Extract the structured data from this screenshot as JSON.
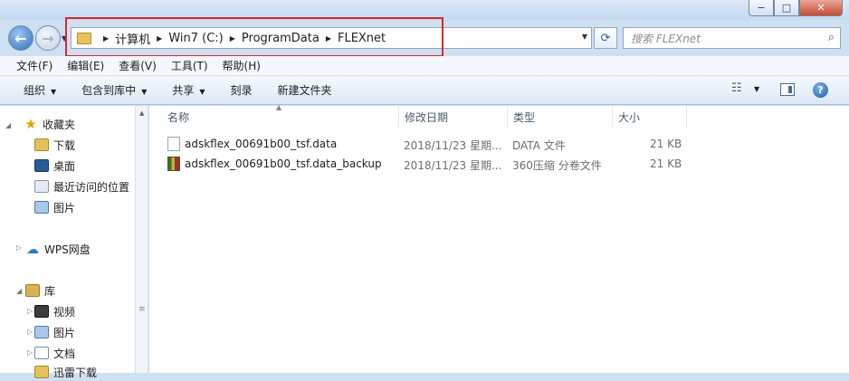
{
  "window": {
    "min": "−",
    "max": "□",
    "close": "✕"
  },
  "breadcrumb": [
    "计算机",
    "Win7 (C:)",
    "ProgramData",
    "FLEXnet"
  ],
  "search": {
    "placeholder": "搜索 FLEXnet"
  },
  "menu": [
    "文件(F)",
    "编辑(E)",
    "查看(V)",
    "工具(T)",
    "帮助(H)"
  ],
  "toolbar": {
    "organize": "组织",
    "include": "包含到库中",
    "share": "共享",
    "burn": "刻录",
    "new_folder": "新建文件夹"
  },
  "nav": {
    "favorites": "收藏夹",
    "downloads": "下载",
    "desktop": "桌面",
    "recent": "最近访问的位置",
    "pictures": "图片",
    "wps": "WPS网盘",
    "library": "库",
    "video": "视频",
    "lib_pictures": "图片",
    "documents": "文档",
    "thunder": "迅雷下载"
  },
  "columns": {
    "name": "名称",
    "date": "修改日期",
    "type": "类型",
    "size": "大小"
  },
  "files": [
    {
      "name": "adskflex_00691b00_tsf.data",
      "date": "2018/11/23 星期...",
      "type": "DATA 文件",
      "size": "21 KB"
    },
    {
      "name": "adskflex_00691b00_tsf.data_backup",
      "date": "2018/11/23 星期...",
      "type": "360压缩 分卷文件",
      "size": "21 KB"
    }
  ]
}
